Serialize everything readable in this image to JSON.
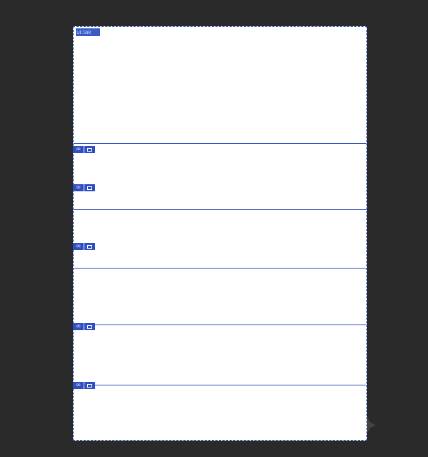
{
  "canvas": {
    "title_label": "ui:tak",
    "rows": [
      {
        "badge_prefix": "oc"
      },
      {
        "badge_prefix": "oc"
      },
      {
        "badge_prefix": "oc"
      },
      {
        "badge_prefix": "oc"
      },
      {
        "badge_prefix": "oc"
      }
    ]
  }
}
